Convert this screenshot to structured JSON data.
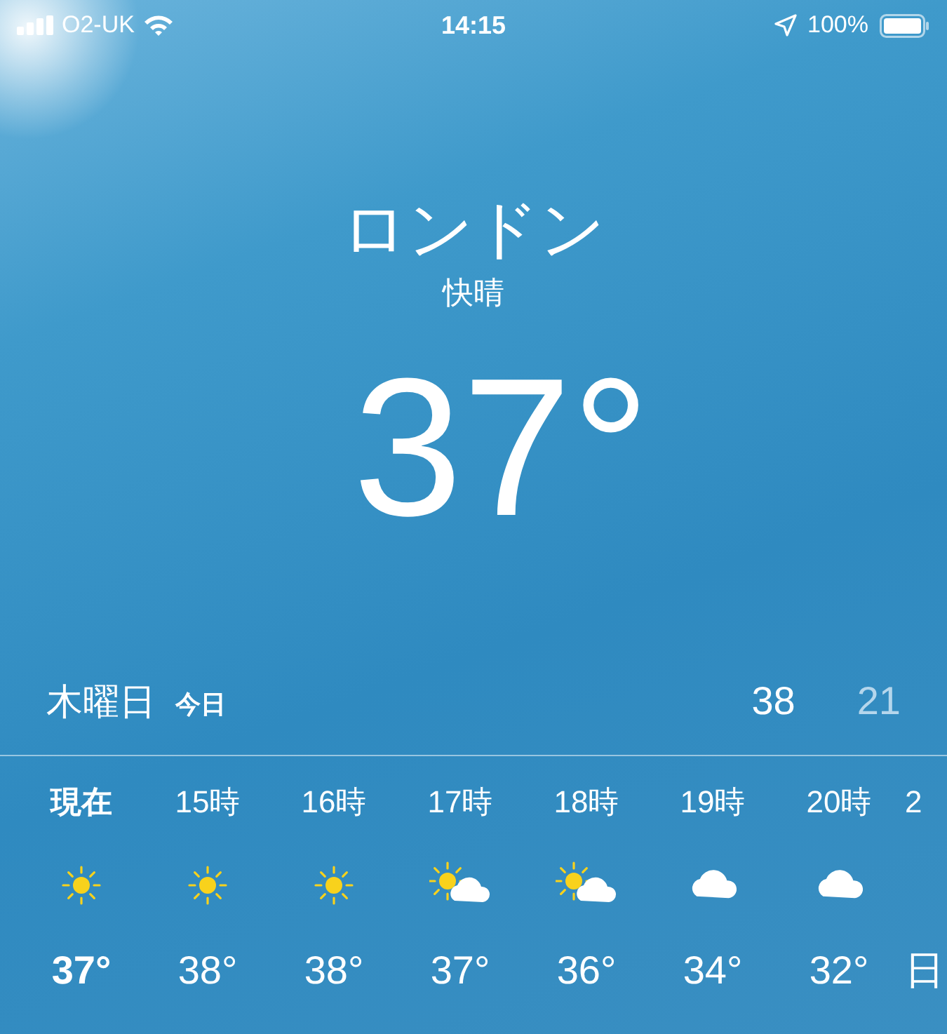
{
  "status_bar": {
    "carrier": "O2-UK",
    "time": "14:15",
    "battery": "100%"
  },
  "location": {
    "city": "ロンドン",
    "condition": "快晴",
    "temperature": "37°"
  },
  "today": {
    "day": "木曜日",
    "label": "今日",
    "high": "38",
    "low": "21"
  },
  "hourly": [
    {
      "kind": "sunny",
      "time": "現在",
      "temp": "37°",
      "selected": true
    },
    {
      "kind": "sunny",
      "time": "15時",
      "temp": "38°",
      "selected": false
    },
    {
      "kind": "sunny",
      "time": "16時",
      "temp": "38°",
      "selected": false
    },
    {
      "kind": "partly_cloudy",
      "time": "17時",
      "temp": "37°",
      "selected": false
    },
    {
      "kind": "partly_cloudy",
      "time": "18時",
      "temp": "36°",
      "selected": false
    },
    {
      "kind": "cloudy",
      "time": "19時",
      "temp": "34°",
      "selected": false
    },
    {
      "kind": "cloudy",
      "time": "20時",
      "temp": "32°",
      "selected": false
    },
    {
      "kind": "cut",
      "time": "2",
      "temp": "日",
      "selected": false
    }
  ]
}
